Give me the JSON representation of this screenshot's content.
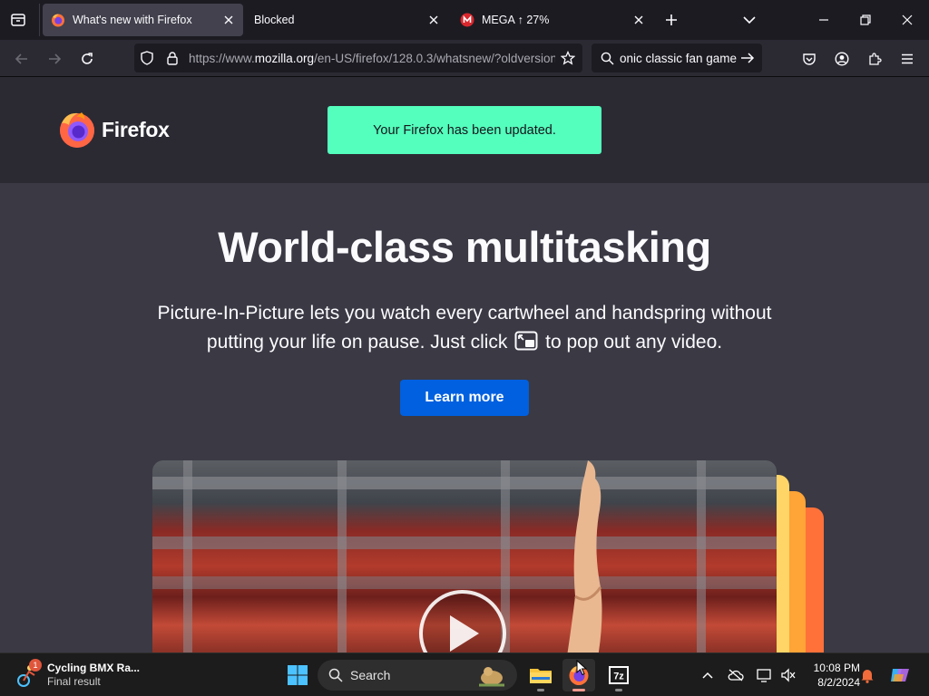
{
  "tabs": [
    {
      "title": "What's new with Firefox",
      "active": true,
      "favicon": "firefox-icon"
    },
    {
      "title": "Blocked",
      "active": false,
      "favicon": ""
    },
    {
      "title": "MEGA ↑ 27%",
      "active": false,
      "favicon": "mega-icon"
    }
  ],
  "navbar": {
    "url_prefix": "https://www.",
    "url_host": "mozilla.org",
    "url_rest": "/en-US/firefox/128.0.3/whatsnew/?oldversion",
    "search_text": "onic classic fan game"
  },
  "page": {
    "logo_text": "Firefox",
    "notice": "Your Firefox has been updated.",
    "headline": "World-class multitasking",
    "blurb_part1": "Picture-In-Picture lets you watch every cartwheel and handspring without putting your life on pause. Just click",
    "blurb_part2": "to pop out any video.",
    "cta_label": "Learn more"
  },
  "taskbar": {
    "widget_badge": "1",
    "widget_title": "Cycling BMX Ra...",
    "widget_subtitle": "Final result",
    "search_label": "Search",
    "apps": [
      "file-explorer",
      "firefox",
      "7-zip"
    ],
    "time": "10:08 PM",
    "date": "8/2/2024"
  },
  "colors": {
    "notice_bg": "#54ffbd",
    "cta_bg": "#0060df",
    "page_bg": "#3a3944",
    "header_bg": "#2b2a33"
  }
}
